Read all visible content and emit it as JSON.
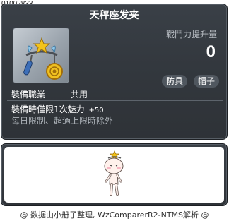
{
  "item_id": "01002833",
  "item": {
    "name": "天秤座发夹",
    "icon": "libra-hairpin-icon"
  },
  "stats": {
    "power_label": "戰鬥力提升量",
    "power_value": "0"
  },
  "categories": [
    "防具",
    "帽子"
  ],
  "job": {
    "label": "裝備職業",
    "value": "共用"
  },
  "effect": {
    "text": "裝備時僅限1次魅力",
    "value": "+50"
  },
  "note": "每日限制、超過上限時除外",
  "preview": {
    "figure": "character-preview-figure"
  },
  "footer": "@ 数据由小册子整理, WzComparerR2-NTMS解析 @",
  "colors": {
    "panel": "#33383e",
    "badge": "#50575f",
    "title": "#ffffff"
  }
}
